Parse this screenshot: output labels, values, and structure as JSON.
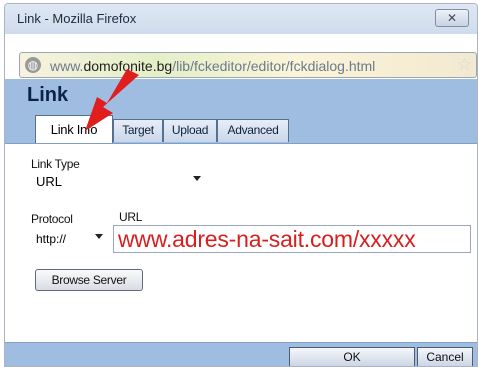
{
  "window": {
    "title": "Link - Mozilla Firefox",
    "close_glyph": "✕"
  },
  "addressbar": {
    "url_prefix": "www.",
    "url_domain": "domofonite.bg",
    "url_path": "/lib/fckeditor/editor/fckdialog.html"
  },
  "dialog": {
    "title": "Link",
    "tabs": [
      {
        "label": "Link Info",
        "active": true
      },
      {
        "label": "Target",
        "active": false
      },
      {
        "label": "Upload",
        "active": false
      },
      {
        "label": "Advanced",
        "active": false
      }
    ]
  },
  "form": {
    "link_type_label": "Link Type",
    "link_type_value": "URL",
    "protocol_label": "Protocol",
    "protocol_value": "http://",
    "url_label": "URL",
    "url_value": "www.adres-na-sait.com/xxxxx",
    "browse_label": "Browse Server"
  },
  "footer": {
    "ok_label": "OK",
    "cancel_label": "Cancel"
  },
  "colors": {
    "accent": "#9fbde0",
    "annotation": "#e01e1e",
    "url_text": "#d81f1f"
  },
  "icons": {
    "globe": "globe-icon",
    "star": "star-icon",
    "close": "close-icon",
    "annotation_arrow": "red-arrow-icon"
  }
}
